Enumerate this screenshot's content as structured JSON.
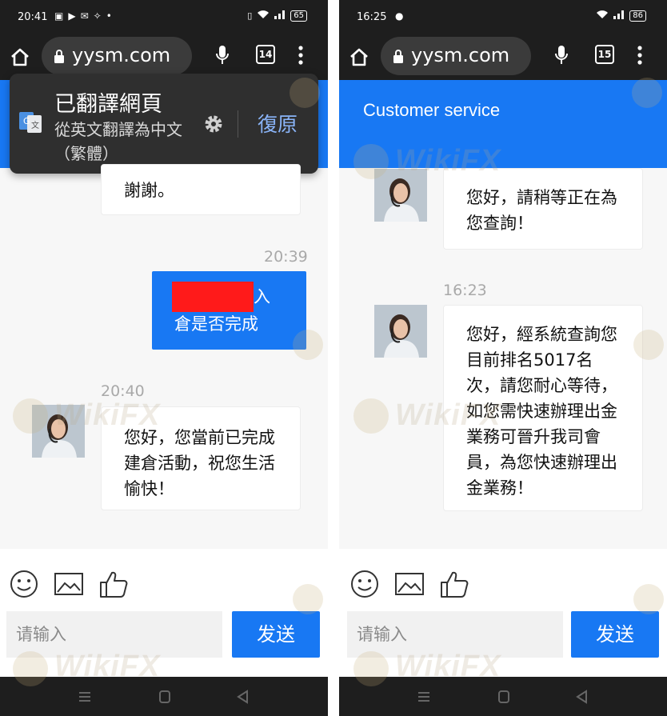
{
  "left": {
    "status": {
      "time": "20:41",
      "battery": "65",
      "notif_icons": [
        "chat-app-icon",
        "youtube-icon",
        "mail-icon",
        "mesh-icon",
        "dot-icon"
      ]
    },
    "address": {
      "url": "yysm.com",
      "tabs": "14"
    },
    "translate": {
      "title": "已翻譯網頁",
      "subtitle": "從英文翻譯為中文（繁體）",
      "restore": "復原"
    },
    "messages": {
      "m0_text": "謝謝。",
      "m1_time": "20:39",
      "m1_text_a": "入",
      "m1_text_b": "倉是否完成",
      "m2_time": "20:40",
      "m2_text": "您好，您當前已完成建倉活動，祝您生活愉快！"
    },
    "input_placeholder": "请输入",
    "send": "发送"
  },
  "right": {
    "status": {
      "time": "16:25",
      "battery": "86"
    },
    "address": {
      "url": "yysm.com",
      "tabs": "15"
    },
    "header_title": "Customer service",
    "messages": {
      "m1_text": "您好，請稍等正在為您查詢！",
      "m2_time": "16:23",
      "m2_text": "您好，經系統查詢您目前排名5017名次，請您耐心等待，如您需快速辦理出金業務可晉升我司會員，為您快速辦理出金業務！"
    },
    "input_placeholder": "请输入",
    "send": "发送"
  },
  "watermark": "WikiFX",
  "colors": {
    "brand_blue": "#1878f3",
    "status_bg": "#1e1e1e",
    "redaction": "#ff1a1a"
  }
}
